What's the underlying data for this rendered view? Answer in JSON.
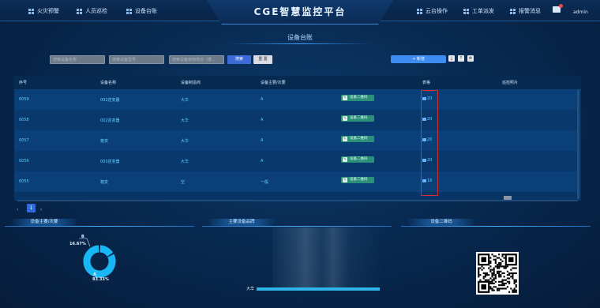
{
  "app": {
    "title": "CGE智慧监控平台",
    "user": "admin"
  },
  "nav_left": [
    {
      "label": "火灾预警",
      "icon": "grid-icon"
    },
    {
      "label": "人员巡检",
      "icon": "grid-icon"
    },
    {
      "label": "设备台账",
      "icon": "grid-icon"
    }
  ],
  "nav_right": [
    {
      "label": "云台操作",
      "icon": "grid-icon"
    },
    {
      "label": "工单派发",
      "icon": "grid-icon"
    },
    {
      "label": "报警消息",
      "icon": "grid-icon"
    }
  ],
  "panel": {
    "title": "设备台账"
  },
  "filters": [
    {
      "placeholder": "搜索设备名称"
    },
    {
      "placeholder": "搜索设备型号"
    },
    {
      "placeholder": "搜索设备使用地点（楼..."
    }
  ],
  "actions": {
    "search": "搜索",
    "reset": "重 置",
    "add": "+ 新增"
  },
  "table": {
    "headers": [
      "序号",
      "设备名称",
      "设备制造商",
      "设备主要/次要",
      "",
      "表格",
      "巡检照片"
    ],
    "qr_label": "设备二维码",
    "rows": [
      {
        "id": "0059",
        "name": "002逆变器",
        "maker": "大华",
        "level": "A",
        "count": "20"
      },
      {
        "id": "0058",
        "name": "002逆变器",
        "maker": "大华",
        "level": "A",
        "count": "20"
      },
      {
        "id": "0057",
        "name": "箱变",
        "maker": "大华",
        "level": "A",
        "count": "20"
      },
      {
        "id": "0056",
        "name": "003逆变器",
        "maker": "大华",
        "level": "A",
        "count": "20"
      },
      {
        "id": "0055",
        "name": "箱变",
        "maker": "空",
        "level": "一般",
        "count": "18"
      }
    ]
  },
  "pagination": {
    "current": "1",
    "prev": "‹",
    "next": "›"
  },
  "sections": [
    {
      "title": "设备主要/次要"
    },
    {
      "title": "主要设备品牌"
    },
    {
      "title": "设备二维码"
    }
  ],
  "chart_data": [
    {
      "type": "pie",
      "title": "设备主要/次要",
      "categories": [
        "B",
        "A"
      ],
      "values": [
        16.67,
        83.33
      ],
      "labels": [
        "16.67%",
        "83.33%"
      ]
    },
    {
      "type": "bar",
      "title": "主要设备品牌",
      "categories": [
        "大华"
      ],
      "values": [
        1
      ]
    }
  ],
  "colors": {
    "accent": "#3f8cf0",
    "donut": "#19b6f5",
    "highlight": "#d03030"
  }
}
